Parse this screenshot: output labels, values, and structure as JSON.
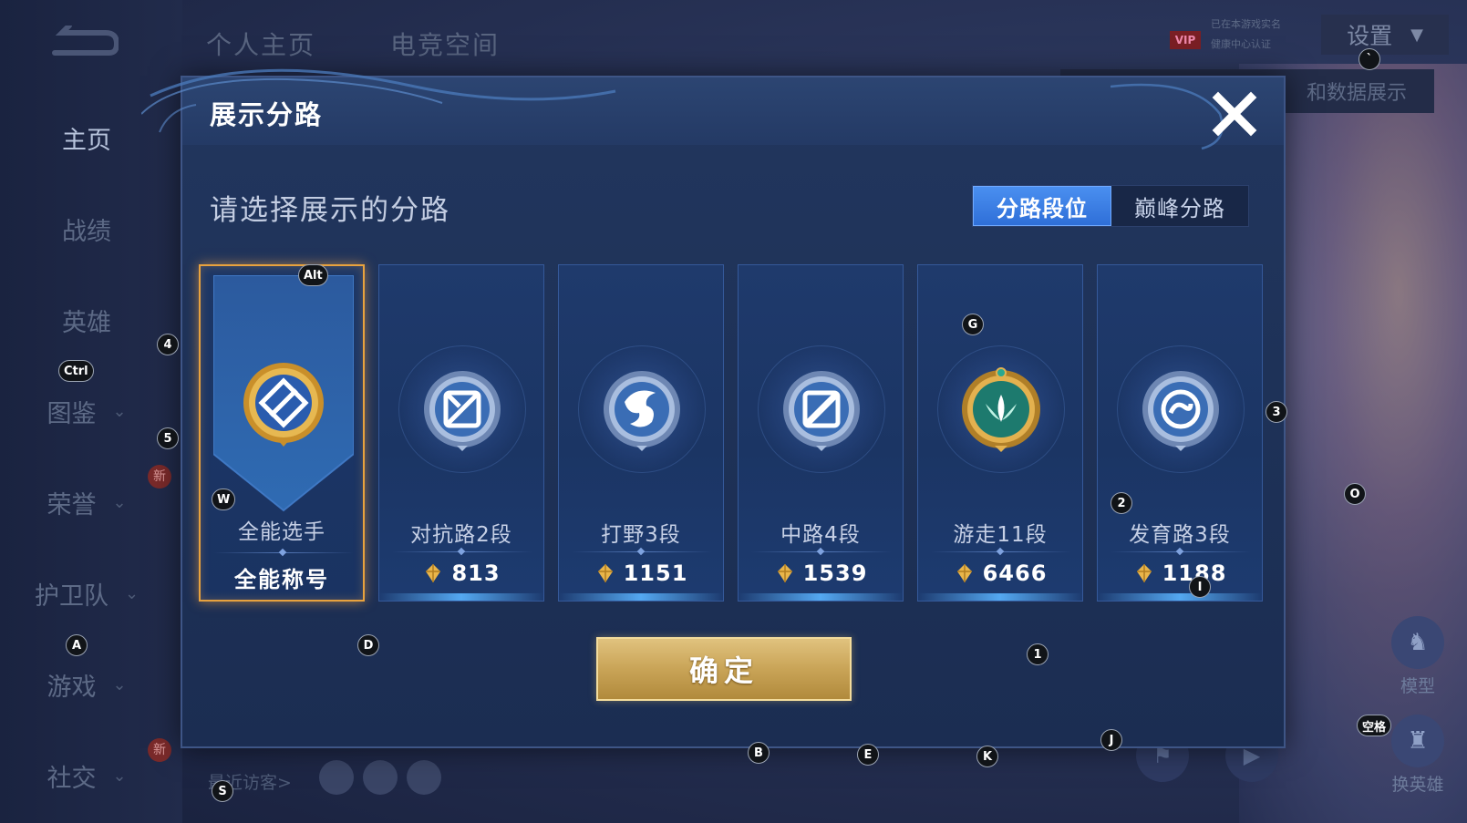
{
  "background": {
    "top_tabs": [
      "个人主页",
      "电竞空间"
    ],
    "sidebar": [
      {
        "label": "主页",
        "active": true,
        "chevron": false,
        "new": false
      },
      {
        "label": "战绩",
        "active": false,
        "chevron": false,
        "new": false
      },
      {
        "label": "英雄",
        "active": false,
        "chevron": false,
        "new": false
      },
      {
        "label": "图鉴",
        "active": false,
        "chevron": true,
        "new": false
      },
      {
        "label": "荣誉",
        "active": false,
        "chevron": true,
        "new": true
      },
      {
        "label": "护卫队",
        "active": false,
        "chevron": true,
        "new": false
      },
      {
        "label": "游戏",
        "active": false,
        "chevron": true,
        "new": false
      },
      {
        "label": "社交",
        "active": false,
        "chevron": true,
        "new": true
      }
    ],
    "new_badge": "新",
    "settings_label": "设置",
    "vip_label": "VIP",
    "vip_line1": "已在本游戏实名",
    "vip_line2": "健康中心认证",
    "data_show_label": "和数据展示",
    "model_label": "模型",
    "swap_hero_label": "换英雄",
    "recent_visitors": "最近访客>"
  },
  "modal": {
    "title": "展示分路",
    "prompt": "请选择展示的分路",
    "segments": [
      {
        "label": "分路段位",
        "active": true
      },
      {
        "label": "巅峰分路",
        "active": false
      }
    ],
    "cards": [
      {
        "name": "全能选手",
        "score": "全能称号",
        "selected": true,
        "icon": "all-round-emblem-icon"
      },
      {
        "name": "对抗路2段",
        "score": "813",
        "selected": false,
        "icon": "clash-lane-emblem-icon"
      },
      {
        "name": "打野3段",
        "score": "1151",
        "selected": false,
        "icon": "jungle-emblem-icon"
      },
      {
        "name": "中路4段",
        "score": "1539",
        "selected": false,
        "icon": "mid-lane-emblem-icon"
      },
      {
        "name": "游走11段",
        "score": "6466",
        "selected": false,
        "icon": "roam-emblem-icon"
      },
      {
        "name": "发育路3段",
        "score": "1188",
        "selected": false,
        "icon": "farm-lane-emblem-icon"
      }
    ],
    "confirm_label": "确定"
  },
  "key_hints": [
    "Alt",
    "4",
    "Ctrl",
    "5",
    "W",
    "G",
    "3",
    "2",
    "O",
    "I",
    "A",
    "D",
    "1",
    "空格",
    "J",
    "B",
    "E",
    "K",
    "S",
    "`"
  ],
  "colors": {
    "accent_blue": "#2f6fd8",
    "selected_border": "#e8a23e",
    "confirm_gold": "#c9a457",
    "panel_bg": "#1e3258"
  }
}
